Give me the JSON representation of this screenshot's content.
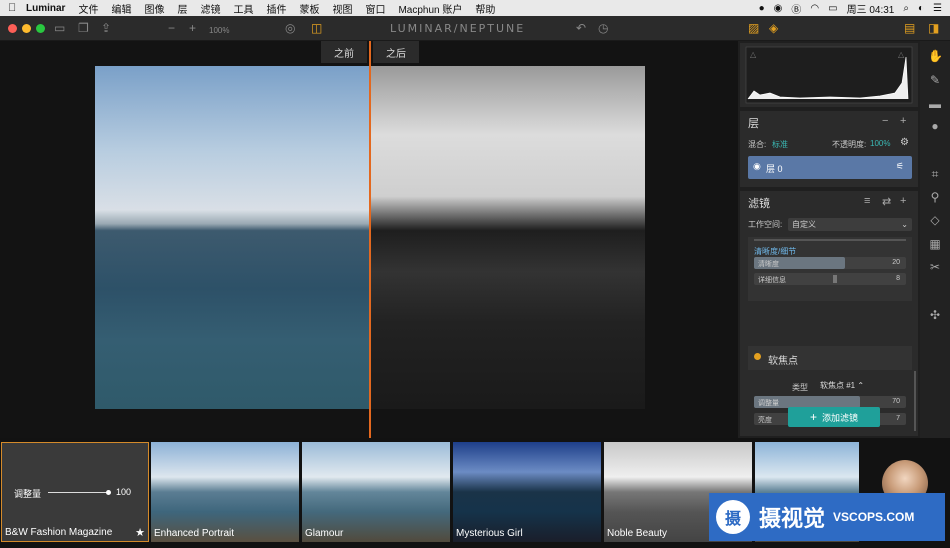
{
  "menubar": {
    "app": "Luminar",
    "items": [
      "文件",
      "编辑",
      "图像",
      "层",
      "滤镜",
      "工具",
      "插件",
      "蒙板",
      "视图",
      "窗口",
      "Macphun 账户",
      "帮助"
    ],
    "clock": "周三 04:31"
  },
  "toolbar": {
    "title": "LUMINAR/NEPTUNE",
    "zoom": "100%"
  },
  "canvas": {
    "before_label": "之前",
    "after_label": "之后"
  },
  "layers": {
    "title": "层",
    "blend_label": "混合:",
    "blend_value": "标准",
    "opacity_label": "不透明度:",
    "opacity_value": "100%",
    "layer_name": "层 0"
  },
  "filters": {
    "title": "滤镜",
    "workspace_label": "工作空间:",
    "workspace_value": "自定义",
    "clarity_header": "清晰度/细节",
    "clarity_sliders": [
      {
        "label": "清晰度",
        "value": "20",
        "fraction": 0.6
      },
      {
        "label": "详细信息",
        "value": "8",
        "fraction": 0.53
      }
    ],
    "softfocus_title": "软焦点",
    "type_label": "类型",
    "type_value": "软焦点 #1 ⌃",
    "softfocus_sliders": [
      {
        "label": "调整量",
        "value": "70",
        "fraction": 0.7
      },
      {
        "label": "亮度",
        "value": "7",
        "fraction": 0.5
      }
    ],
    "add_button": "添加滤镜"
  },
  "filmstrip": {
    "amount_label": "调整量",
    "amount_value": "100",
    "presets": [
      {
        "name": "B&W Fashion Magazine"
      },
      {
        "name": "Enhanced Portrait"
      },
      {
        "name": "Glamour"
      },
      {
        "name": "Mysterious Girl"
      },
      {
        "name": "Noble Beauty"
      }
    ]
  },
  "watermark": {
    "logo_glyph": "摄",
    "brand": "摄视觉",
    "domain": "VSCOPS.COM"
  },
  "colors": {
    "accent_orange": "#e3681f",
    "teal": "#1fa09a",
    "layer_blue": "#5a78a6"
  }
}
